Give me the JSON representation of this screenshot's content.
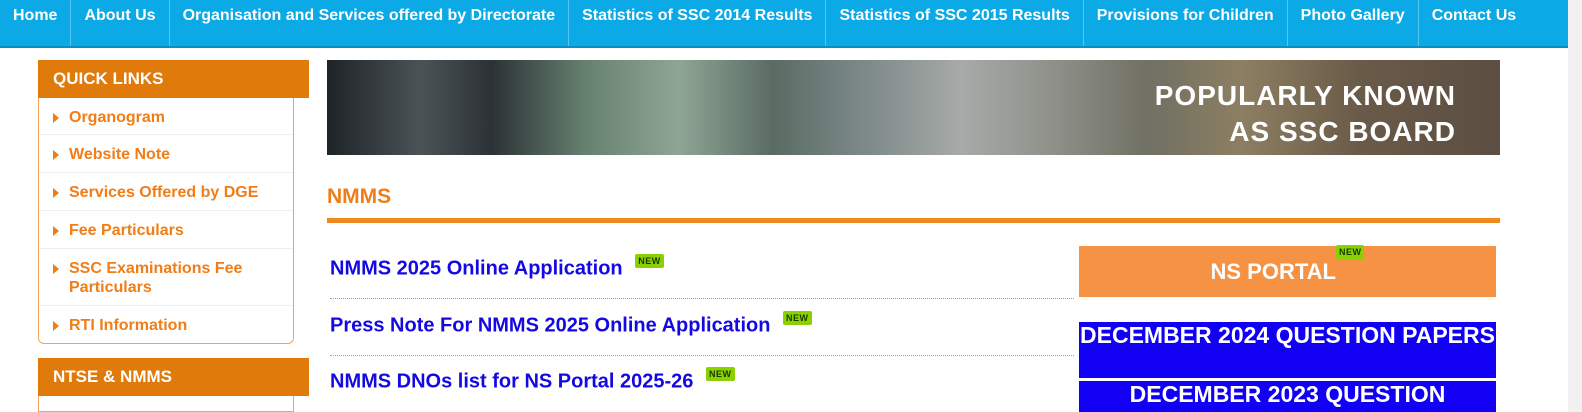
{
  "nav": {
    "items": [
      {
        "label": "Home"
      },
      {
        "label": "About Us"
      },
      {
        "label": "Organisation and Services offered by Directorate"
      },
      {
        "label": "Statistics of SSC 2014 Results"
      },
      {
        "label": "Statistics of SSC 2015 Results"
      },
      {
        "label": "Provisions for Children"
      },
      {
        "label": "Photo Gallery"
      },
      {
        "label": "Contact Us"
      }
    ]
  },
  "sidebar": {
    "quick_links_title": "QUICK LINKS",
    "quick_links": [
      {
        "label": "Organogram"
      },
      {
        "label": "Website Note"
      },
      {
        "label": "Services Offered by DGE"
      },
      {
        "label": "Fee Particulars"
      },
      {
        "label": "SSC Examinations Fee Particulars"
      },
      {
        "label": "RTI Information"
      }
    ],
    "ntse_title": "NTSE & NMMS"
  },
  "banner": {
    "line1": "POPULARLY KNOWN",
    "line2": "AS SSC BOARD"
  },
  "main": {
    "title": "NMMS",
    "new_badge": "NEW",
    "items": [
      {
        "label": "NMMS 2025 Online Application"
      },
      {
        "label": "Press Note For NMMS 2025 Online Application"
      },
      {
        "label": "NMMS DNOs list for NS Portal 2025-26"
      }
    ]
  },
  "right": {
    "portal_label": "NS PORTAL",
    "qp_buttons": [
      {
        "label": "DECEMBER 2024 QUESTION PAPERS"
      },
      {
        "label": "DECEMBER 2023 QUESTION"
      }
    ]
  },
  "colors": {
    "nav_bg": "#0ba9e6",
    "accent_orange": "#e07a0a",
    "link_blue": "#1409e0",
    "badge_green": "#8bd000"
  }
}
